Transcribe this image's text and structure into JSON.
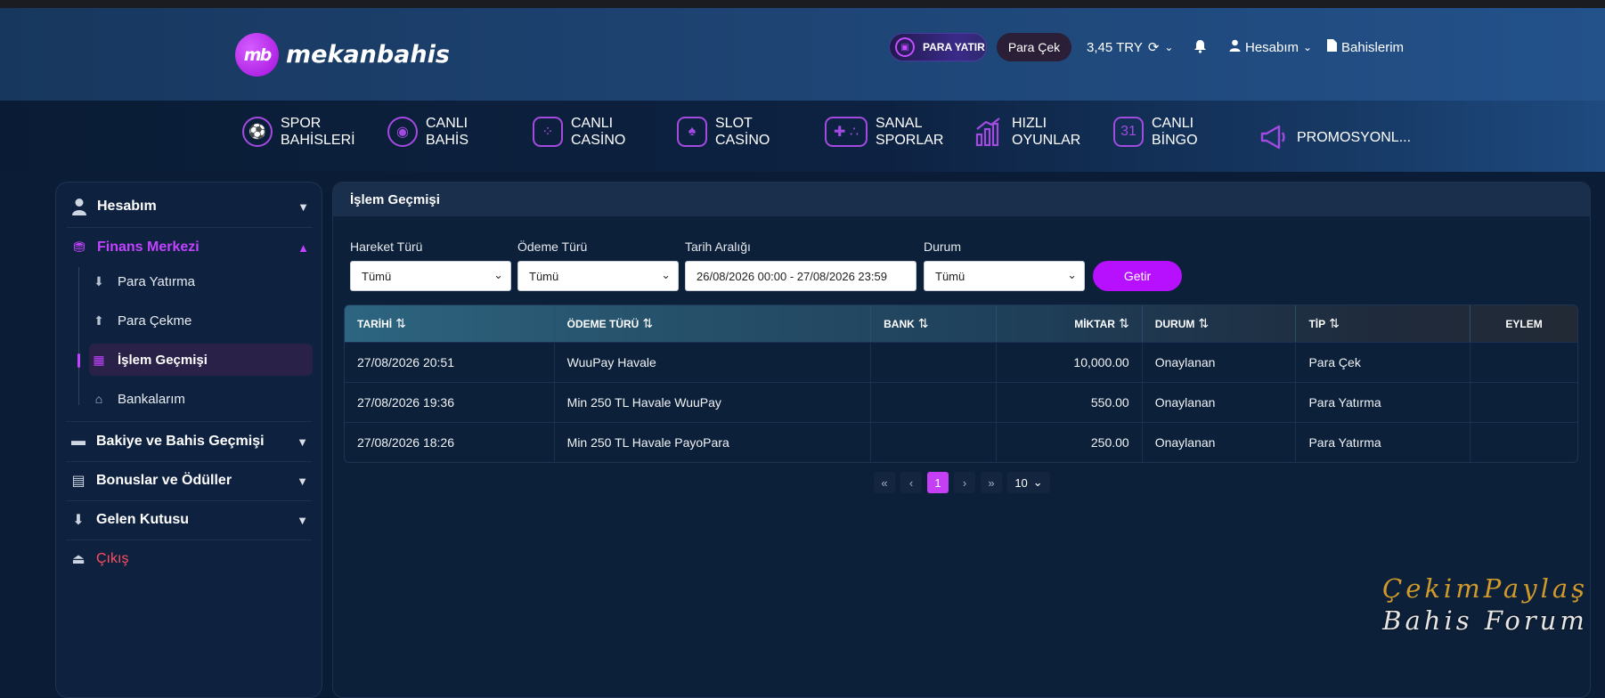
{
  "brand": {
    "logo_mark": "mb",
    "logo_text": "mekanbahis"
  },
  "header": {
    "deposit_label": "PARA YATIR",
    "withdraw_label": "Para Çek",
    "balance": "3,45 TRY",
    "account_label": "Hesabım",
    "bets_label": "Bahislerim"
  },
  "nav": [
    {
      "line1": "SPOR",
      "line2": "BAHİSLERİ",
      "icon": "soccer-ball-icon"
    },
    {
      "line1": "CANLI",
      "line2": "BAHİS",
      "icon": "live-signal-icon"
    },
    {
      "line1": "CANLI",
      "line2": "CASİNO",
      "icon": "dice-icon"
    },
    {
      "line1": "SLOT",
      "line2": "CASİNO",
      "icon": "cards-icon"
    },
    {
      "line1": "SANAL",
      "line2": "SPORLAR",
      "icon": "gamepad-icon"
    },
    {
      "line1": "HIZLI",
      "line2": "OYUNLAR",
      "icon": "chart-icon"
    },
    {
      "line1": "CANLI",
      "line2": "BİNGO",
      "icon": "bingo-icon"
    },
    {
      "line1": "PROMOSYONL...",
      "line2": "",
      "icon": "megaphone-icon"
    }
  ],
  "sidebar": {
    "account": "Hesabım",
    "finance": "Finans Merkezi",
    "sub": [
      "Para Yatırma",
      "Para Çekme",
      "İşlem Geçmişi",
      "Bankalarım"
    ],
    "balance_history": "Bakiye ve Bahis Geçmişi",
    "bonuses": "Bonuslar ve Ödüller",
    "inbox": "Gelen Kutusu",
    "logout": "Çıkış"
  },
  "main": {
    "title": "İşlem Geçmişi",
    "filters": {
      "movement_label": "Hareket Türü",
      "movement_value": "Tümü",
      "payment_label": "Ödeme Türü",
      "payment_value": "Tümü",
      "date_label": "Tarih Aralığı",
      "date_value": "26/08/2026 00:00 - 27/08/2026 23:59",
      "status_label": "Durum",
      "status_value": "Tümü",
      "submit_label": "Getir"
    },
    "table": {
      "headers": [
        "TARİHİ",
        "ÖDEME TÜRÜ",
        "BANK",
        "MİKTAR",
        "DURUM",
        "TİP",
        "EYLEM"
      ],
      "rows": [
        [
          "27/08/2026 20:51",
          "WuuPay Havale",
          "",
          "10,000.00",
          "Onaylanan",
          "Para Çek",
          ""
        ],
        [
          "27/08/2026 19:36",
          "Min 250 TL Havale WuuPay",
          "",
          "550.00",
          "Onaylanan",
          "Para Yatırma",
          ""
        ],
        [
          "27/08/2026 18:26",
          "Min 250 TL Havale PayoPara",
          "",
          "250.00",
          "Onaylanan",
          "Para Yatırma",
          ""
        ]
      ]
    },
    "pagination": {
      "current": "1",
      "page_size": "10"
    }
  },
  "watermark": {
    "line1": "ÇekimPaylaş",
    "line2": "Bahis Forum"
  },
  "colors": {
    "accent": "#b610ff",
    "logout": "#ff4d5e",
    "finance": "#c142ff"
  }
}
